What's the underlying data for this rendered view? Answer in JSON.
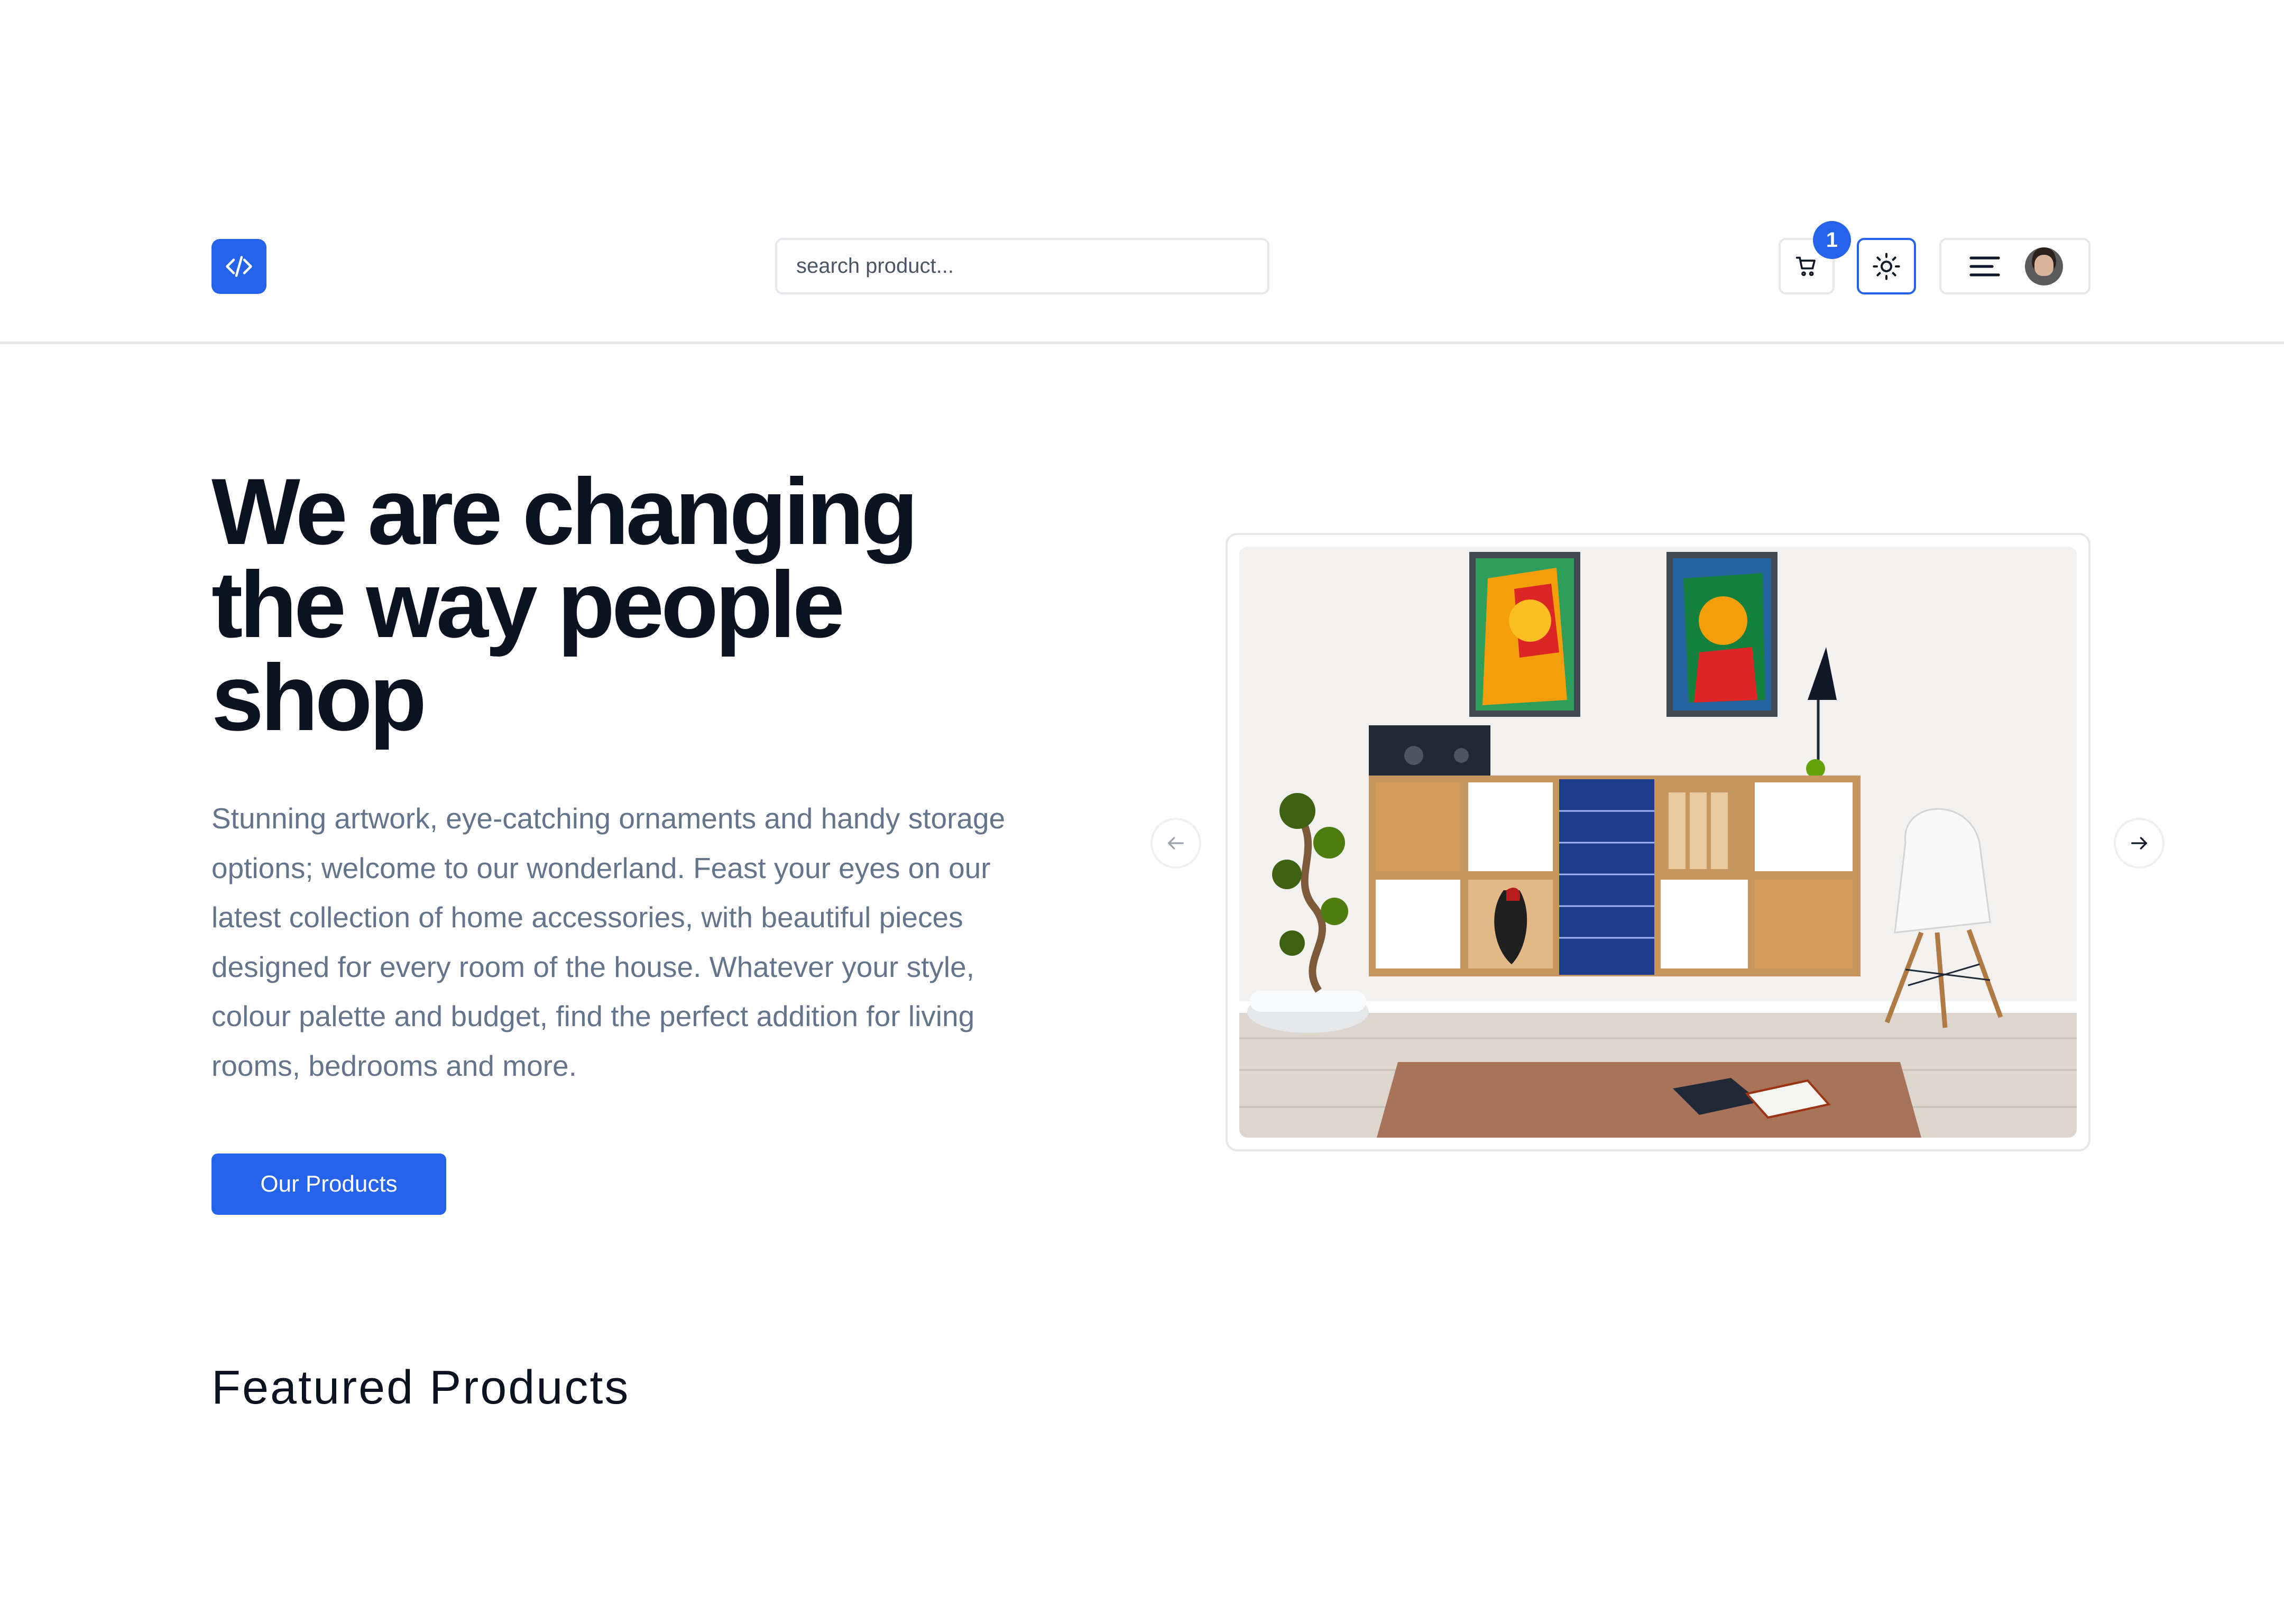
{
  "header": {
    "search_placeholder": "search product...",
    "cart_count": "1"
  },
  "hero": {
    "title": "We are changing the way people shop",
    "description": "Stunning artwork, eye-catching ornaments and handy storage options; welcome to our wonderland. Feast your eyes on our latest collection of home accessories, with beautiful pieces designed for every room of the house. Whatever your style, colour palette and budget, find the perfect addition for living rooms, bedrooms and more.",
    "cta_label": "Our Products"
  },
  "featured": {
    "title": "Featured Products"
  },
  "icons": {
    "logo": "code-icon",
    "cart": "shopping-cart-icon",
    "theme": "sun-icon",
    "menu": "menu-icon",
    "prev": "arrow-left-icon",
    "next": "arrow-right-icon"
  },
  "colors": {
    "accent": "#2563eb",
    "heading": "#0b1220",
    "body_text": "#64748b",
    "border": "#e5e7eb"
  }
}
